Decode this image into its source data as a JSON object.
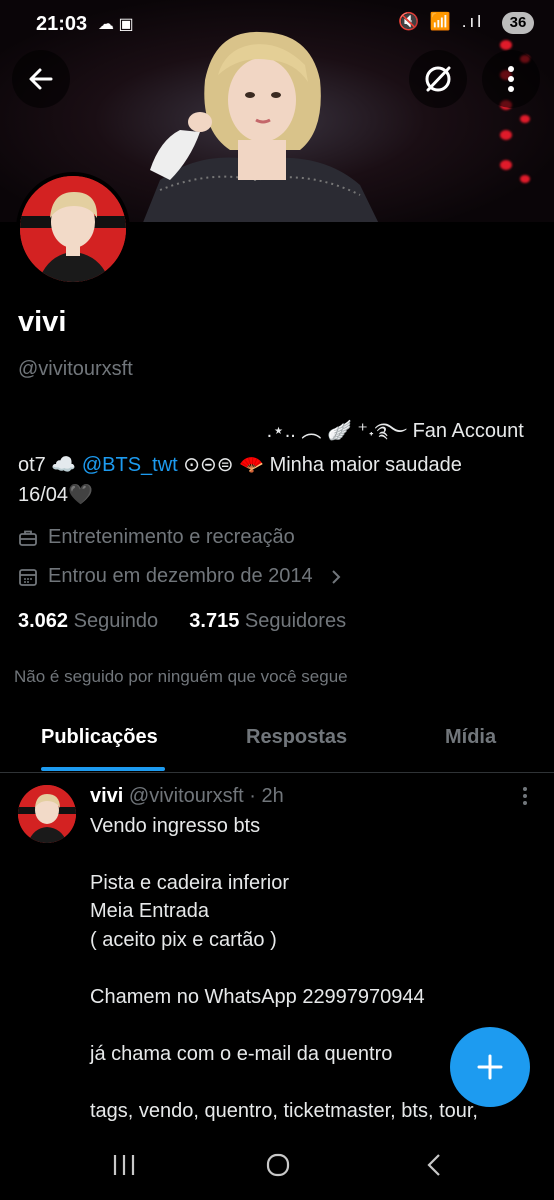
{
  "status_bar": {
    "time": "21:03",
    "left_icons": "☁ ▣",
    "right_icons": "🔇 📶 .ıl",
    "battery": "36"
  },
  "header": {
    "back_icon": "arrow-left-icon",
    "subscribe_icon": "verified-subscribe-icon",
    "more_icon": "more-vertical-icon"
  },
  "profile": {
    "name": "vivi",
    "handle": "@vivitourxsft",
    "fan_account_line": "⠀.⋆.. ︵ 🪽 ⁺˖࿐ Fan Account",
    "bio_prefix": "ot7 ☁️ ",
    "bio_mention": "@BTS_twt",
    "bio_suffix": " ⊙⊝⊜ 🪭 Minha maior saudade",
    "bio_line2": "16/04🖤",
    "category": "Entretenimento e recreação",
    "joined": "Entrou em dezembro de 2014",
    "following_count": "3.062",
    "following_label": "Seguindo",
    "followers_count": "3.715",
    "followers_label": "Seguidores",
    "not_followed": "Não é seguido por ninguém que você segue"
  },
  "tabs": [
    {
      "label": "Publicações",
      "active": true
    },
    {
      "label": "Respostas",
      "active": false
    },
    {
      "label": "Mídia",
      "active": false
    }
  ],
  "tweet": {
    "name": "vivi",
    "handle": "@vivitourxsft",
    "time": "· 2h",
    "lines": [
      "Vendo ingresso bts",
      "",
      "Pista e cadeira inferior",
      "Meia Entrada",
      "( aceito pix e cartão )",
      "",
      "Chamem no WhatsApp 22997970944",
      "",
      "já chama com o e-mail da quentro",
      "",
      "tags, vendo, quentro, ticketmaster, bts, tour,"
    ]
  },
  "fab": {
    "icon": "plus-icon"
  },
  "nav": {
    "recent_icon": "recent-apps-icon",
    "home_icon": "home-icon",
    "back_icon": "back-icon"
  },
  "colors": {
    "accent": "#1d9bf0",
    "muted": "#71767b",
    "background": "#000000"
  }
}
